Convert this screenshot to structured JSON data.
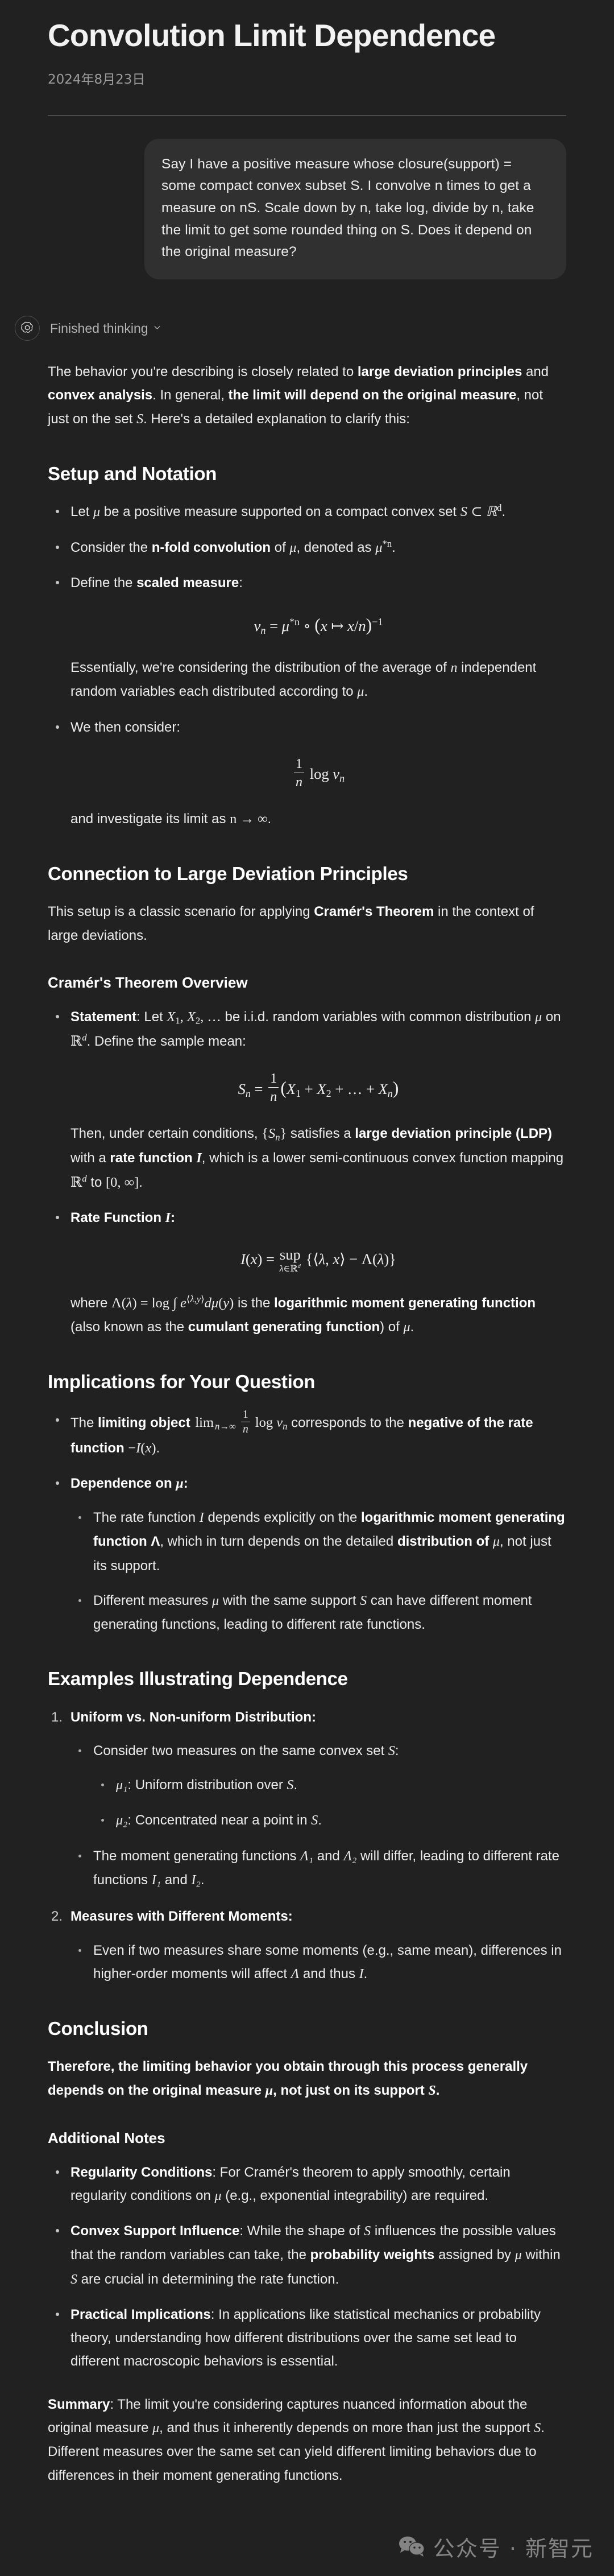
{
  "header": {
    "title": "Convolution Limit Dependence",
    "date": "2024年8月23日"
  },
  "user_message": {
    "text": "Say I have a positive measure whose closure(support) = some compact convex subset S.  I convolve n times to get a measure on nS. Scale down by n, take log, divide by n, take the limit to get some rounded thing on S.  Does it depend on the original measure?"
  },
  "assistant": {
    "thinking_label": "Finished thinking",
    "chevron_icon": "chevron-down-icon",
    "avatar_icon": "openai-logo-icon",
    "intro": {
      "p1_a": "The behavior you're describing is closely related to ",
      "p1_b": "large deviation principles",
      "p1_c": " and ",
      "p1_d": "convex analysis",
      "p1_e": ". In general, ",
      "p1_f": "the limit will depend on the original measure",
      "p1_g": ", not just on the set ",
      "p1_h": "S",
      "p1_i": ". Here's a detailed explanation to clarify this:"
    },
    "sections": {
      "setup": {
        "heading": "Setup and Notation",
        "b1_a": "Let ",
        "b1_mu": "μ",
        "b1_b": " be a positive measure supported on a compact convex set ",
        "b1_set": "S ⊂ ℝ",
        "b1_sup": "d",
        "b1_c": ".",
        "b2_a": "Consider the ",
        "b2_b": "n-fold convolution",
        "b2_c": " of ",
        "b2_mu": "μ",
        "b2_d": ", denoted as ",
        "b2_e": "μ",
        "b2_sup": "*n",
        "b2_f": ".",
        "b3_a": "Define the ",
        "b3_b": "scaled measure",
        "b3_c": ":",
        "eq_nu": "ν_n = μ^{*n} ∘ (x ↦ x/n)^{-1}",
        "essentially_a": "Essentially, we're considering the distribution of the average of ",
        "essentially_n": "n",
        "essentially_b": " independent random variables each distributed according to ",
        "essentially_mu": "μ",
        "essentially_c": ".",
        "b4": "We then consider:",
        "eq_limit": "(1/n) log ν_n",
        "investigate_a": "and investigate its limit as ",
        "investigate_b": "n → ∞",
        "investigate_c": "."
      },
      "ldp": {
        "heading": "Connection to Large Deviation Principles",
        "intro_a": "This setup is a classic scenario for applying ",
        "intro_b": "Cramér's Theorem",
        "intro_c": " in the context of large deviations.",
        "sub_heading": "Cramér's Theorem Overview",
        "statement_label": "Statement",
        "statement_a": ": Let ",
        "statement_vars": "X₁, X₂, …",
        "statement_b": " be i.i.d. random variables with common distribution ",
        "statement_mu": "μ",
        "statement_c": " on ",
        "statement_rd": "ℝ",
        "statement_d": "d",
        "statement_e": ". Define the sample mean:",
        "eq_sn": "S_n = (1/n)(X₁ + X₂ + … + X_n)",
        "then_a": "Then, under certain conditions, ",
        "then_sn": "{S_n}",
        "then_b": " satisfies a ",
        "then_c": "large deviation principle (LDP)",
        "then_d": " with a ",
        "then_e": "rate function ",
        "then_I": "I",
        "then_f": ", which is a lower semi-continuous convex function mapping ",
        "then_rd": "ℝ",
        "then_g": "d",
        "then_h": " to ",
        "then_range": "[0, ∞]",
        "then_i": ".",
        "rate_label": "Rate Function ",
        "rate_I": "I",
        "rate_colon": ":",
        "eq_rate": "I(x) = sup_{λ∈ℝ^d} {⟨λ, x⟩ − Λ(λ)}",
        "where_a": "where ",
        "where_eq": "Λ(λ) = log ∫ e^{⟨λ,y⟩} dμ(y)",
        "where_b": " is the ",
        "where_c": "logarithmic moment generating function",
        "where_d": " (also known as the ",
        "where_e": "cumulant generating function",
        "where_f": ") of ",
        "where_mu": "μ",
        "where_g": "."
      },
      "implications": {
        "heading": "Implications for Your Question",
        "b1_a": "The ",
        "b1_b": "limiting object ",
        "b1_eq": "lim_{n→∞} (1/n) log ν_n",
        "b1_c": " corresponds to the ",
        "b1_d": "negative of the rate function",
        "b1_e": " ",
        "b1_f": "−I(x)",
        "b1_g": ".",
        "b2_label": "Dependence on ",
        "b2_mu": "μ",
        "b2_colon": ":",
        "n1_a": "The rate function ",
        "n1_I": "I",
        "n1_b": " depends explicitly on the ",
        "n1_c": "logarithmic moment generating function ",
        "n1_lambda": "Λ",
        "n1_d": ", which in turn depends on the detailed ",
        "n1_e": "distribution of ",
        "n1_mu": "μ",
        "n1_f": ", not just its support.",
        "n2_a": "Different measures ",
        "n2_mu": "μ",
        "n2_b": " with the same support ",
        "n2_S": "S",
        "n2_c": " can have different moment generating functions, leading to different rate functions."
      },
      "examples": {
        "heading": "Examples Illustrating Dependence",
        "item1_label": "Uniform vs. Non-uniform Distribution:",
        "item1_b1_a": "Consider two measures on the same convex set ",
        "item1_b1_S": "S",
        "item1_b1_b": ":",
        "item1_b1_s1_mu": "μ₁",
        "item1_b1_s1_a": ": Uniform distribution over ",
        "item1_b1_s1_S": "S",
        "item1_b1_s1_b": ".",
        "item1_b1_s2_mu": "μ₂",
        "item1_b1_s2_a": ": Concentrated near a point in ",
        "item1_b1_s2_S": "S",
        "item1_b1_s2_b": ".",
        "item1_b2_a": "The moment generating functions ",
        "item1_b2_L1": "Λ₁",
        "item1_b2_b": " and ",
        "item1_b2_L2": "Λ₂",
        "item1_b2_c": " will differ, leading to different rate functions ",
        "item1_b2_I1": "I₁",
        "item1_b2_d": " and ",
        "item1_b2_I2": "I₂",
        "item1_b2_e": ".",
        "item2_label": "Measures with Different Moments:",
        "item2_b1_a": "Even if two measures share some moments (e.g., same mean), differences in higher-order moments will affect ",
        "item2_b1_L": "Λ",
        "item2_b1_b": " and thus ",
        "item2_b1_I": "I",
        "item2_b1_c": "."
      },
      "conclusion": {
        "heading": "Conclusion",
        "text_a": "Therefore, the limiting behavior you obtain through this process generally depends on the original measure ",
        "text_mu": "μ",
        "text_b": ", not just on its support ",
        "text_S": "S",
        "text_c": "."
      },
      "notes": {
        "heading": "Additional Notes",
        "n1_label": "Regularity Conditions",
        "n1_a": ": For Cramér's theorem to apply smoothly, certain regularity conditions on ",
        "n1_mu": "μ",
        "n1_b": " (e.g., exponential integrability) are required.",
        "n2_label": "Convex Support Influence",
        "n2_a": ": While the shape of ",
        "n2_S": "S",
        "n2_b": " influences the possible values that the random variables can take, the ",
        "n2_c": "probability weights",
        "n2_d": " assigned by ",
        "n2_mu": "μ",
        "n2_e": " within ",
        "n2_S2": "S",
        "n2_f": " are crucial in determining the rate function.",
        "n3_label": "Practical Implications",
        "n3_a": ": In applications like statistical mechanics or probability theory, understanding how different distributions over the same set lead to different macroscopic behaviors is essential."
      },
      "summary": {
        "label": "Summary",
        "a": ": The limit you're considering captures nuanced information about the original measure ",
        "mu": "μ",
        "b": ", and thus it inherently depends on more than just the support ",
        "S": "S",
        "c": ". Different measures over the same set can yield different limiting behaviors due to differences in their moment generating functions."
      }
    }
  },
  "watermark": {
    "icon": "wechat-icon",
    "text": "公众号 · 新智元"
  },
  "colors": {
    "background": "#212121",
    "bubble": "#303030",
    "text": "#ececec",
    "muted": "#9b9b9b",
    "divider": "#4a4a4a"
  }
}
